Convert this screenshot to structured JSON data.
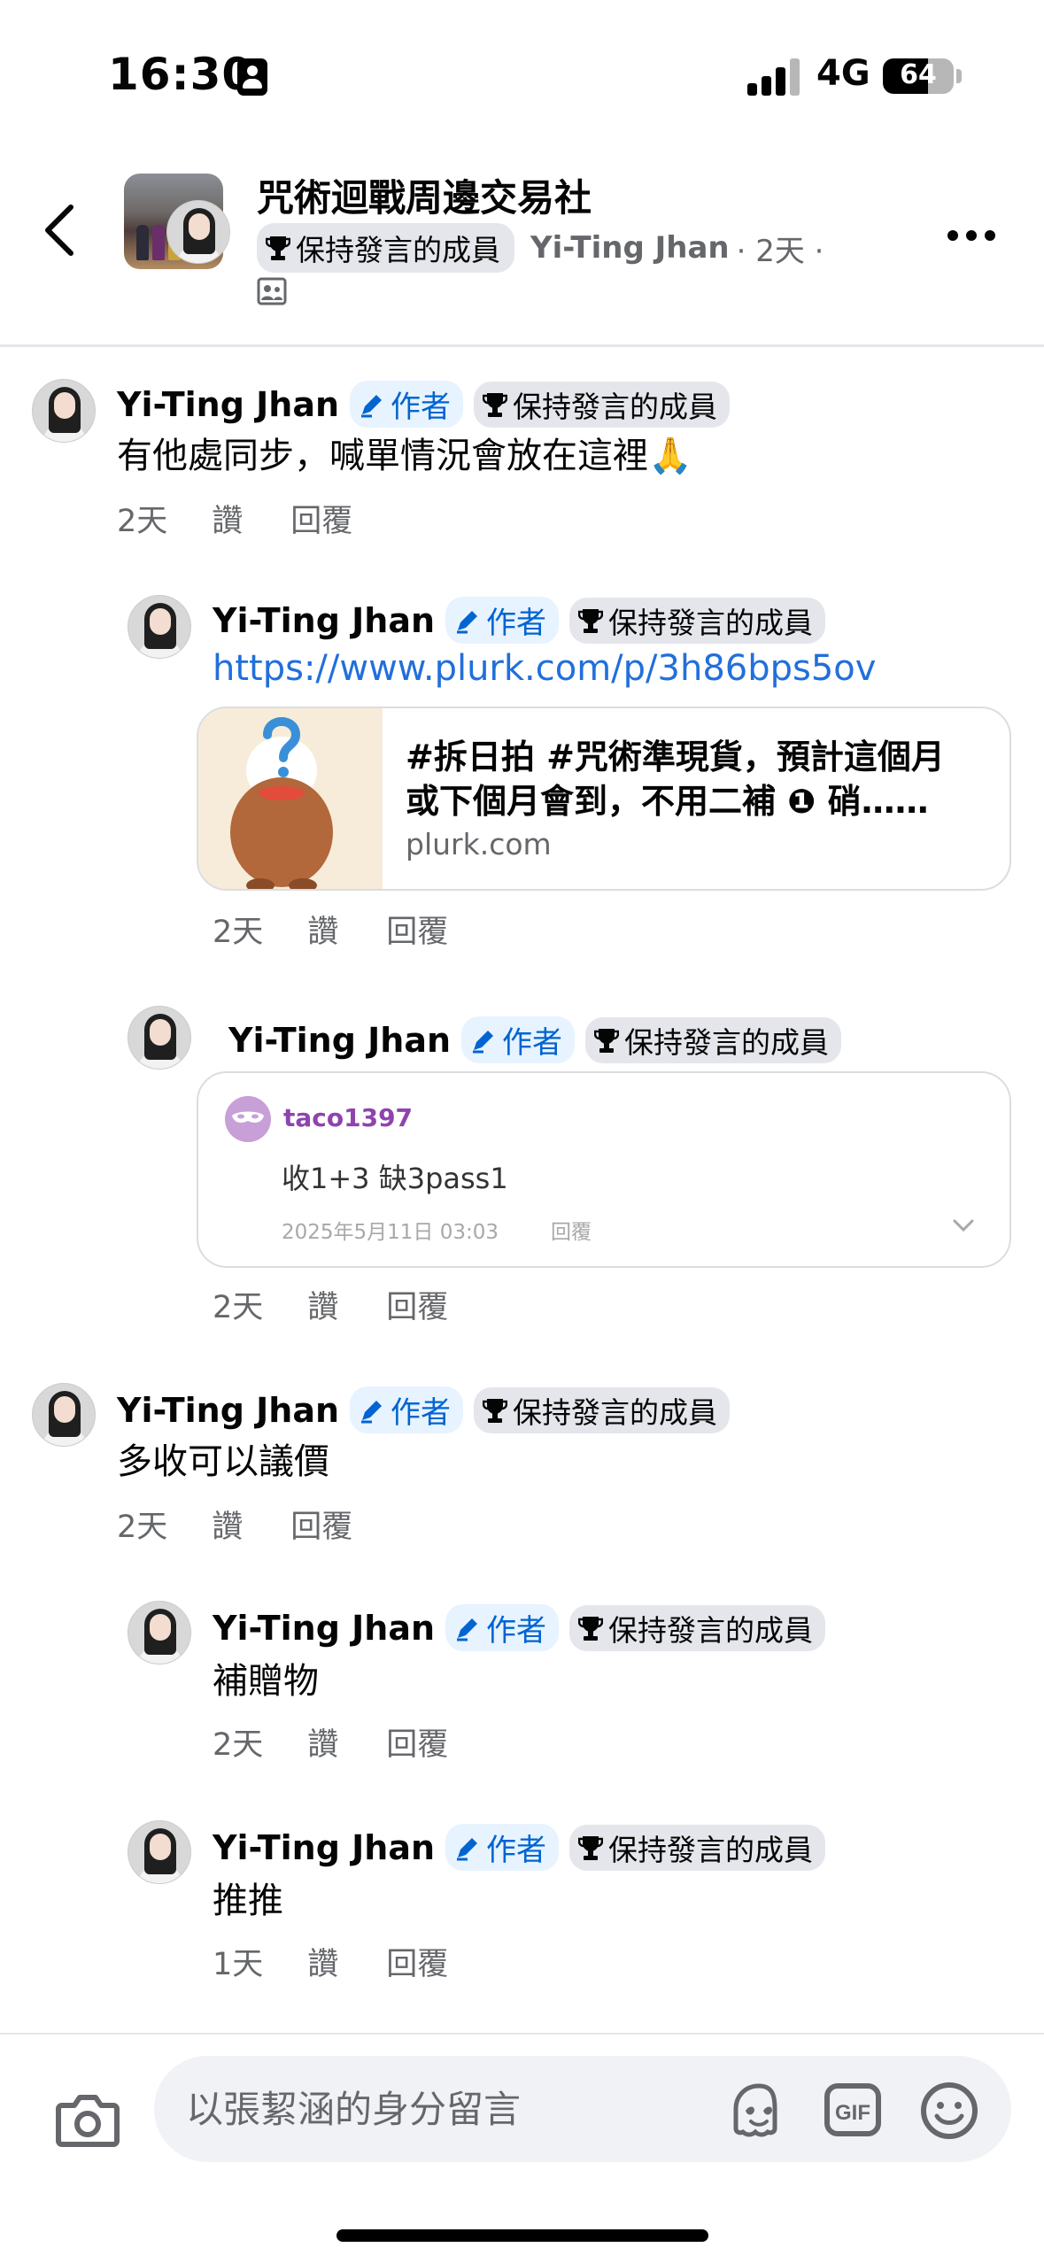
{
  "status_bar": {
    "time": "16:30",
    "network": "4G",
    "battery": "64",
    "battery_level": 0.64
  },
  "header": {
    "group_name": "咒術迴戰周邊交易社",
    "member_badge": "保持發言的成員",
    "author": "Yi-Ting Jhan",
    "meta": "· 2天 ·"
  },
  "badges": {
    "author": "作者",
    "member": "保持發言的成員"
  },
  "actions": {
    "like": "讚",
    "reply": "回覆"
  },
  "comments": [
    {
      "name": "Yi-Ting Jhan",
      "text": "有他處同步，喊單情況會放在這裡🙏",
      "time": "2天"
    },
    {
      "name": "Yi-Ting Jhan",
      "link": "https://www.plurk.com/p/3h86bps5ov",
      "time": "2天"
    },
    {
      "name": "Yi-Ting Jhan",
      "time": "2天"
    },
    {
      "name": "Yi-Ting Jhan",
      "text": "多收可以議價",
      "time": "2天"
    },
    {
      "name": "Yi-Ting Jhan",
      "text": "補贈物",
      "time": "2天"
    },
    {
      "name": "Yi-Ting Jhan",
      "text": "推推",
      "time": "1天"
    }
  ],
  "link_preview": {
    "title_line1": "#拆日拍 #咒術準現貨，預計這個月",
    "title_line2": "或下個月會到，不用二補 ❶ 硝……",
    "domain": "plurk.com"
  },
  "quoted": {
    "user": "taco1397",
    "text": "收1+3 缺3pass1",
    "date": "2025年5月11日 03:03",
    "reply": "回覆"
  },
  "composer": {
    "placeholder": "以張絜涵的身分留言"
  }
}
